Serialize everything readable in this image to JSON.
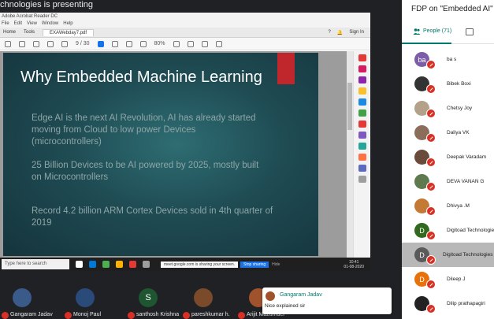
{
  "meeting": {
    "presenting_banner": "chnologies is presenting"
  },
  "acrobat": {
    "window_title": "Adobe Acrobat Reader DC",
    "menu": [
      "File",
      "Edit",
      "View",
      "Window",
      "Help"
    ],
    "tab_label": "EXAWebday7.pdf",
    "help_icon": "help-icon",
    "signin": "Sign In",
    "page_nav": "9 / 30",
    "zoom": "80%"
  },
  "slide": {
    "title": "Why Embedded Machine Learning",
    "bullets": [
      "Edge AI is the next AI Revolution, AI has already started moving from Cloud to low power Devices (microcontrollers)",
      "25 Billion Devices to be AI powered by 2025, mostly built on Microcontrollers",
      "Record 4.2 billion ARM Cortex Devices sold in 4th quarter of 2019"
    ],
    "colors": {
      "accent_bar": "#c0272d",
      "background": "#1f4b53"
    }
  },
  "taskbar": {
    "search_placeholder": "Type here to search",
    "sharing_notice": "meet.google.com is sharing your screen.",
    "stop_sharing": "Stop sharing",
    "hide": "Hide",
    "time": "10:41",
    "date": "01-08-2020"
  },
  "people_panel": {
    "title": "FDP on \"Embedded AI\"",
    "people_tab": "People (71)",
    "accent": "#00796b",
    "participants": [
      {
        "name": "ba s",
        "initials": "ba",
        "color": "#7b5ea7"
      },
      {
        "name": "Bibek Boxi",
        "initials": "",
        "color": "#333333"
      },
      {
        "name": "Chetsy Joy",
        "initials": "",
        "color": "#b3a189"
      },
      {
        "name": "Daliya VK",
        "initials": "",
        "color": "#8a6d5a"
      },
      {
        "name": "Deepak Varadam",
        "initials": "",
        "color": "#6a4a3a"
      },
      {
        "name": "DEVA VANAN G",
        "initials": "",
        "color": "#5e7a4e"
      },
      {
        "name": "Dhivya .M",
        "initials": "",
        "color": "#c47a34"
      },
      {
        "name": "Digitoad Technologies",
        "initials": "D",
        "color": "#33691e"
      },
      {
        "name": "Digitoad Technologies",
        "initials": "D",
        "color": "#5a5a5a",
        "active": true
      },
      {
        "name": "Dileep J",
        "initials": "D",
        "color": "#e8710a"
      },
      {
        "name": "Dilip prathapagiri",
        "initials": "",
        "color": "#222222"
      }
    ]
  },
  "tiles": [
    {
      "name": "Gangaram Jadav",
      "initials": "",
      "color": "#3a5a8a"
    },
    {
      "name": "Monoj Paul",
      "initials": "",
      "color": "#2a4a7a"
    },
    {
      "name": "santhosh Krishna",
      "initials": "S",
      "color": "#1e5631"
    },
    {
      "name": "pareshkumar h.",
      "initials": "",
      "color": "#7a4a2a"
    },
    {
      "name": "Arijit Mazumder",
      "initials": "",
      "color": "#a0522d"
    }
  ],
  "toast": {
    "sender": "Gangaram Jadav",
    "message": "Nice explained sir"
  }
}
